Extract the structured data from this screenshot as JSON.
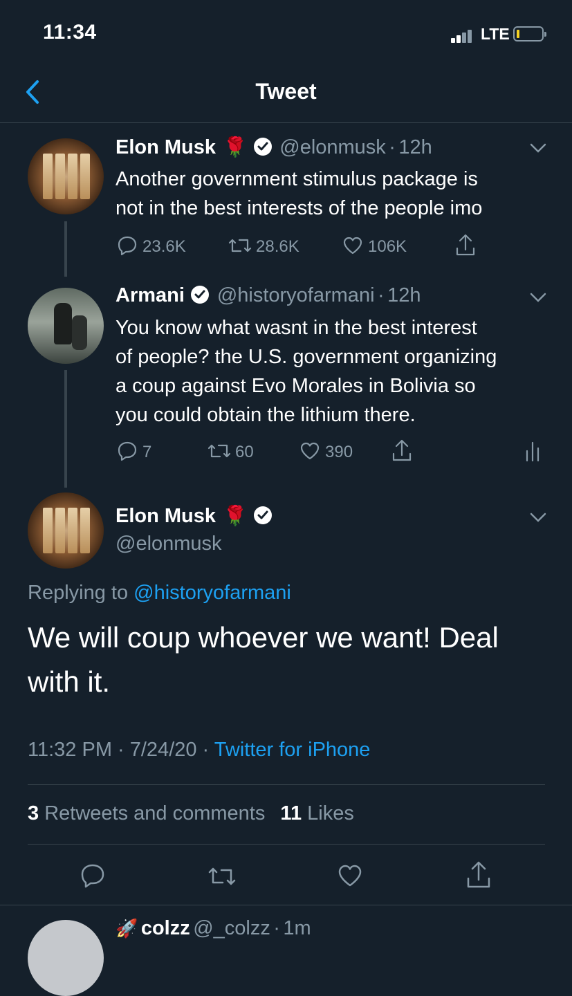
{
  "status_bar": {
    "time": "11:34",
    "network": "LTE"
  },
  "nav": {
    "title": "Tweet"
  },
  "tweets": [
    {
      "name": "Elon Musk",
      "emoji": "🌹",
      "handle": "@elonmusk",
      "time": "12h",
      "text_lines": [
        "Another government stimulus package is",
        "not in the best interests of the people imo"
      ],
      "replies": "23.6K",
      "retweets": "28.6K",
      "likes": "106K"
    },
    {
      "name": "Armani",
      "handle": "@historyofarmani",
      "time": "12h",
      "text_lines": [
        "You know what wasnt in the best interest",
        "of people? the U.S. government organizing",
        "a coup against Evo Morales in Bolivia so",
        "you could obtain the lithium there."
      ],
      "replies": "7",
      "retweets": "60",
      "likes": "390"
    }
  ],
  "main_tweet": {
    "name": "Elon Musk",
    "emoji": "🌹",
    "handle": "@elonmusk",
    "replying_prefix": "Replying to",
    "replying_handle": "@historyofarmani",
    "text_lines": [
      "We will coup whoever we want! Deal",
      "with it."
    ],
    "timestamp": "11:32 PM · 7/24/20 ·",
    "source": "Twitter for iPhone",
    "retweets_count": "3",
    "retweets_label": "Retweets and comments",
    "likes_count": "11",
    "likes_label": "Likes"
  },
  "next_reply": {
    "name": "colzz",
    "handle": "@_colzz",
    "time": "1m"
  },
  "colors": {
    "background": "#15202b",
    "accent": "#1da1f2",
    "muted": "#8899a6",
    "divider": "#38444d"
  }
}
